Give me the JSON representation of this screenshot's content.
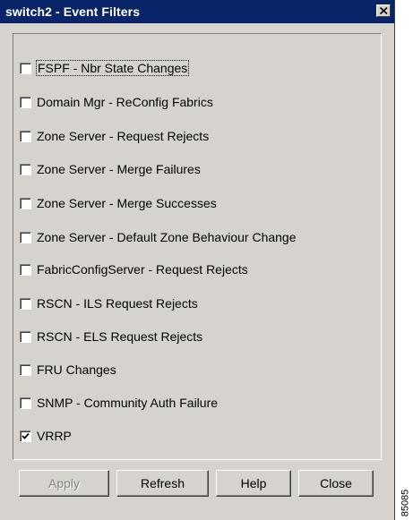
{
  "window": {
    "title": "switch2 - Event Filters",
    "close_symbol": "close-icon"
  },
  "filters": [
    {
      "label": "FSPF - Nbr State Changes",
      "checked": false,
      "focused": true
    },
    {
      "label": "Domain Mgr - ReConfig Fabrics",
      "checked": false
    },
    {
      "label": "Zone Server - Request Rejects",
      "checked": false
    },
    {
      "label": "Zone Server - Merge Failures",
      "checked": false
    },
    {
      "label": "Zone Server - Merge Successes",
      "checked": false
    },
    {
      "label": "Zone Server - Default Zone Behaviour Change",
      "checked": false
    },
    {
      "label": "FabricConfigServer - Request Rejects",
      "checked": false
    },
    {
      "label": "RSCN - ILS Request Rejects",
      "checked": false
    },
    {
      "label": "RSCN - ELS Request Rejects",
      "checked": false
    },
    {
      "label": "FRU Changes",
      "checked": false
    },
    {
      "label": "SNMP - Community Auth Failure",
      "checked": false
    },
    {
      "label": "VRRP",
      "checked": true
    }
  ],
  "buttons": {
    "apply": {
      "label": "Apply",
      "enabled": false
    },
    "refresh": {
      "label": "Refresh",
      "enabled": true
    },
    "help": {
      "label": "Help",
      "enabled": true
    },
    "close": {
      "label": "Close",
      "enabled": true
    }
  },
  "watermark": "85085",
  "colors": {
    "titlebar": "#0a246a",
    "dialog_face": "#d6d3ce"
  }
}
